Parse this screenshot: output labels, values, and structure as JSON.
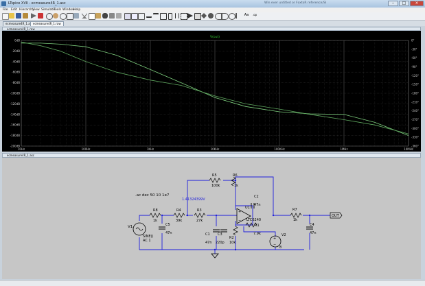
{
  "window": {
    "title": "LTspice XVII - ecmeasure4R_1.asc",
    "hint": "Win ever untitled or FoxtoR reference/SI",
    "minimize": "–",
    "maximize": "□",
    "close": "×"
  },
  "menu": [
    "File",
    "Edit",
    "Hierarchy",
    "View",
    "Simulate",
    "Tools",
    "Window",
    "Help"
  ],
  "toolbar": {
    "icons": [
      "new-icon",
      "open-icon",
      "save-icon",
      "control-panel-icon",
      "run-icon",
      "halt-icon",
      "zoom-in-icon",
      "pan-icon",
      "zoom-out-icon",
      "zoom-fit-icon",
      "autorange-icon",
      "cut-icon",
      "copy-icon",
      "paste-icon",
      "find-icon",
      "print-icon",
      "setup-icon",
      "tile-icon",
      "cascade-icon",
      "close-windows-icon",
      "wire-icon",
      "ground-icon",
      "label-icon",
      "resistor-icon",
      "capacitor-icon",
      "inductor-icon",
      "diode-icon",
      "component-icon",
      "move-icon",
      "drag-icon",
      "undo-icon",
      "redo-icon",
      "rotate-icon",
      "mirror-icon",
      "text-icon",
      "spice-directive-icon"
    ],
    "text_icon_label": "Aa",
    "directive_label": ".op"
  },
  "tabs": [
    {
      "label": "ecmeasure4R_1.asc"
    },
    {
      "label": "ecmeasure4R_1.raw"
    }
  ],
  "plot": {
    "header": "ecmeasure4R_1.raw",
    "trace_label": "V(out)",
    "colors": {
      "trace": "#7fd07f",
      "grid": "#3a3a3a",
      "text": "#cfcfcf",
      "label": "#32cd32"
    }
  },
  "chart_data": {
    "type": "line",
    "title": "",
    "xscale": "log",
    "xlim": [
      10,
      10000000
    ],
    "x_ticks": [
      "10Hz",
      "100Hz",
      "1KHz",
      "10KHz",
      "100KHz",
      "1MHz",
      "10MHz"
    ],
    "y_left_ticks": [
      "0dB",
      "-20dB",
      "-40dB",
      "-60dB",
      "-80dB",
      "-100dB",
      "-120dB",
      "-140dB",
      "-160dB",
      "-180dB",
      "-200dB"
    ],
    "ylim_left": [
      -200,
      0
    ],
    "y_right_ticks": [
      "0°",
      "-30°",
      "-60°",
      "-90°",
      "-120°",
      "-150°",
      "-180°",
      "-210°",
      "-240°",
      "-270°",
      "-300°",
      "-330°",
      "-360°"
    ],
    "ylim_right": [
      -360,
      0
    ],
    "grid": true,
    "series": [
      {
        "name": "V(out)",
        "x": [
          10,
          20,
          40,
          100,
          300,
          1000,
          3000,
          10000,
          30000,
          100000,
          300000,
          1000000,
          3000000,
          10000000
        ],
        "y": [
          -5,
          -5,
          -7,
          -12,
          -28,
          -55,
          -80,
          -108,
          -125,
          -135,
          -139,
          -140,
          -155,
          -180
        ]
      },
      {
        "name": "",
        "x": [
          10,
          20,
          40,
          100,
          300,
          1000,
          3000,
          10000,
          30000,
          100000,
          300000,
          1000000,
          3000000,
          10000000
        ],
        "y": [
          -3,
          -10,
          -20,
          -40,
          -60,
          -75,
          -85,
          -105,
          -120,
          -130,
          -140,
          -150,
          -160,
          -177
        ]
      }
    ]
  },
  "schematic": {
    "header": "ecmeasure4R_1.asc",
    "directive": ".ac dec 50 10 1e7",
    "node_voltage": "1.41324399V",
    "out_label": "OUT",
    "colors": {
      "wire": "#1e1edc",
      "component": "#000000",
      "bg": "#c6c6c6",
      "node": "#1e1edc"
    },
    "components": {
      "V1": {
        "name": "V1",
        "value": "SINE()",
        "value2": "AC 1"
      },
      "R8": {
        "name": "R8",
        "value": "1k"
      },
      "R4": {
        "name": "R4",
        "value": "39k"
      },
      "R3": {
        "name": "R3",
        "value": "27k"
      },
      "C5": {
        "name": "C5",
        "value": "47n"
      },
      "R5": {
        "name": "R5",
        "value": "100k"
      },
      "R6": {
        "name": "R6",
        "value": "1k"
      },
      "C2": {
        "name": "C2",
        "value": "47n"
      },
      "U1": {
        "name": "U1",
        "value": "LTC6240"
      },
      "R1": {
        "name": "R1",
        "value": "7.9k"
      },
      "C1": {
        "name": "C1",
        "value": "47n"
      },
      "C3": {
        "name": "C3",
        "value": "220p"
      },
      "R2": {
        "name": "R2",
        "value": "10k"
      },
      "R7": {
        "name": "R7",
        "value": "1k"
      },
      "C4": {
        "name": "C4",
        "value": "47n"
      },
      "V2": {
        "name": "V2",
        "value": "8"
      }
    }
  }
}
